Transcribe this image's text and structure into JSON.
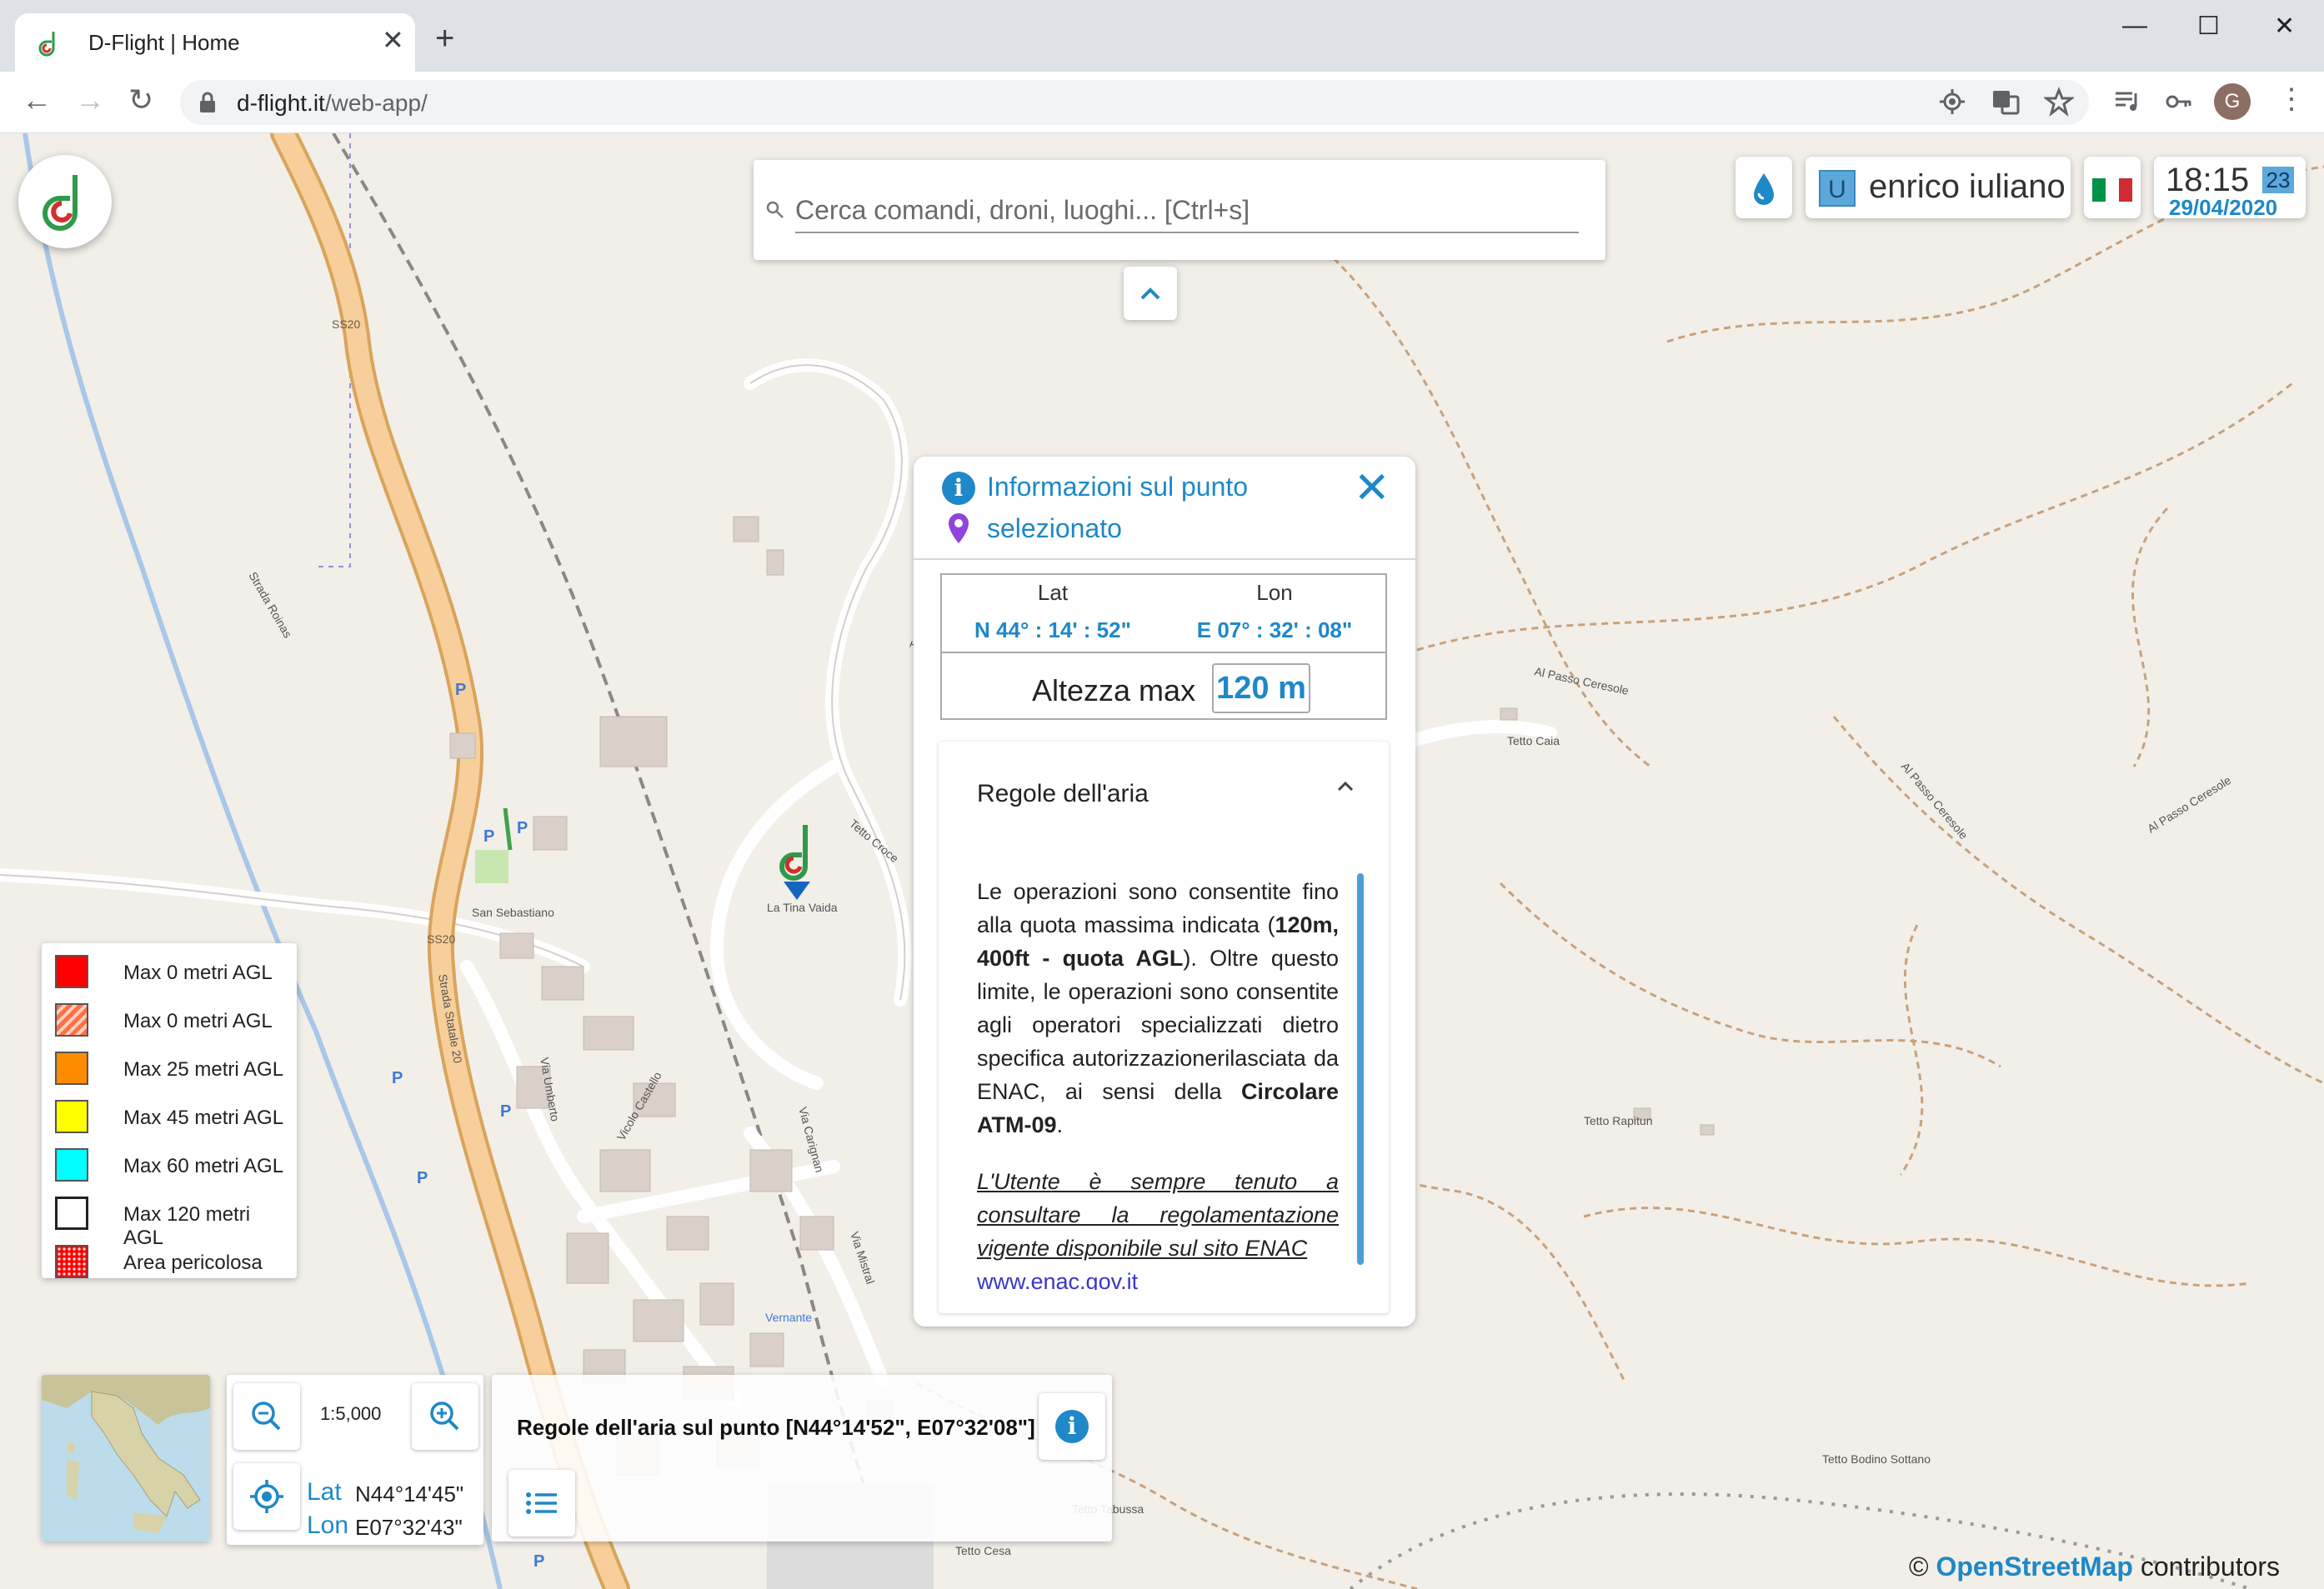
{
  "browser": {
    "tab_title": "D-Flight | Home",
    "tab_close": "✕",
    "new_tab": "+",
    "url_host": "d-flight.it",
    "url_path": "/web-app/",
    "window": {
      "minimize": "—",
      "maximize": "☐",
      "close": "✕"
    },
    "avatar_letter": "G"
  },
  "search": {
    "placeholder": "Cerca comandi, droni, luoghi... [Ctrl+s]"
  },
  "header": {
    "user_initial": "U",
    "user_name": "enrico iuliano",
    "time": "18:15",
    "seconds": "23",
    "date": "29/04/2020"
  },
  "info_panel": {
    "title_line1": "Informazioni sul punto",
    "title_line2": "selezionato",
    "lat_label": "Lat",
    "lon_label": "Lon",
    "lat_value": "N 44° : 14' : 52\"",
    "lon_value": "E 07° : 32' : 08\"",
    "alt_label": "Altezza max",
    "alt_value": "120 m",
    "rules_title": "Regole dell'aria",
    "rules_p1_a": "Le operazioni sono consentite fino alla quota massima indicata (",
    "rules_p1_b": "120m, 400ft - quota AGL",
    "rules_p1_c": "). Oltre questo limite, le operazioni sono consentite agli operatori specializzati dietro specifica autorizzazionerilasciata da ENAC, ai sensi della ",
    "rules_p1_d": "Circolare ATM-09",
    "rules_p1_e": ".",
    "rules_p2": "L'Utente è sempre tenuto a consultare la regolamentazione vigente disponibile sul sito ENAC",
    "rules_link": "www.enac.gov.it"
  },
  "legend": [
    {
      "label": "Max 0 metri AGL",
      "color": "#ff0000",
      "pattern": "solid"
    },
    {
      "label": "Max 0 metri AGL",
      "color": "#ff7043",
      "pattern": "hatched"
    },
    {
      "label": "Max 25 metri AGL",
      "color": "#ff8c00",
      "pattern": "solid"
    },
    {
      "label": "Max 45 metri AGL",
      "color": "#ffff00",
      "pattern": "solid"
    },
    {
      "label": "Max 60 metri AGL",
      "color": "#00ffff",
      "pattern": "solid"
    },
    {
      "label": "Max 120 metri AGL",
      "color": "#ffffff",
      "pattern": "solid"
    },
    {
      "label": "Area pericolosa",
      "color": "#ff0000",
      "pattern": "dotted"
    }
  ],
  "controls": {
    "scale": "1:5,000",
    "lat_label": "Lat",
    "lon_label": "Lon",
    "lat_value": "N44°14'45\"",
    "lon_value": "E07°32'43\""
  },
  "rules_bar": {
    "text": "Regole dell'aria sul punto [N44°14'52\", E07°32'08\"]"
  },
  "attribution": {
    "copyright": "©",
    "osm": "OpenStreetMap",
    "suffix": " contributors"
  },
  "map_labels": {
    "road1": "Strada Roinas",
    "road2": "SS20",
    "road3": "Strada Statale 20",
    "road4": "Via Umberto",
    "road5": "Vicolo Castello",
    "road6": "Via Carignan",
    "road7": "Via Mistral",
    "road8": "Al Passo Ceresole",
    "road9": "Tetto Croce",
    "road10": "Tetto Caia",
    "road11": "Tetto Rapitun",
    "road12": "Tetto Tabussa",
    "road13": "Tetto Cesa",
    "road14": "Tetto Bodino Sottano",
    "road15": "San Sebastiano",
    "road16": "Vernante",
    "road17": "La Tina Vaida"
  }
}
